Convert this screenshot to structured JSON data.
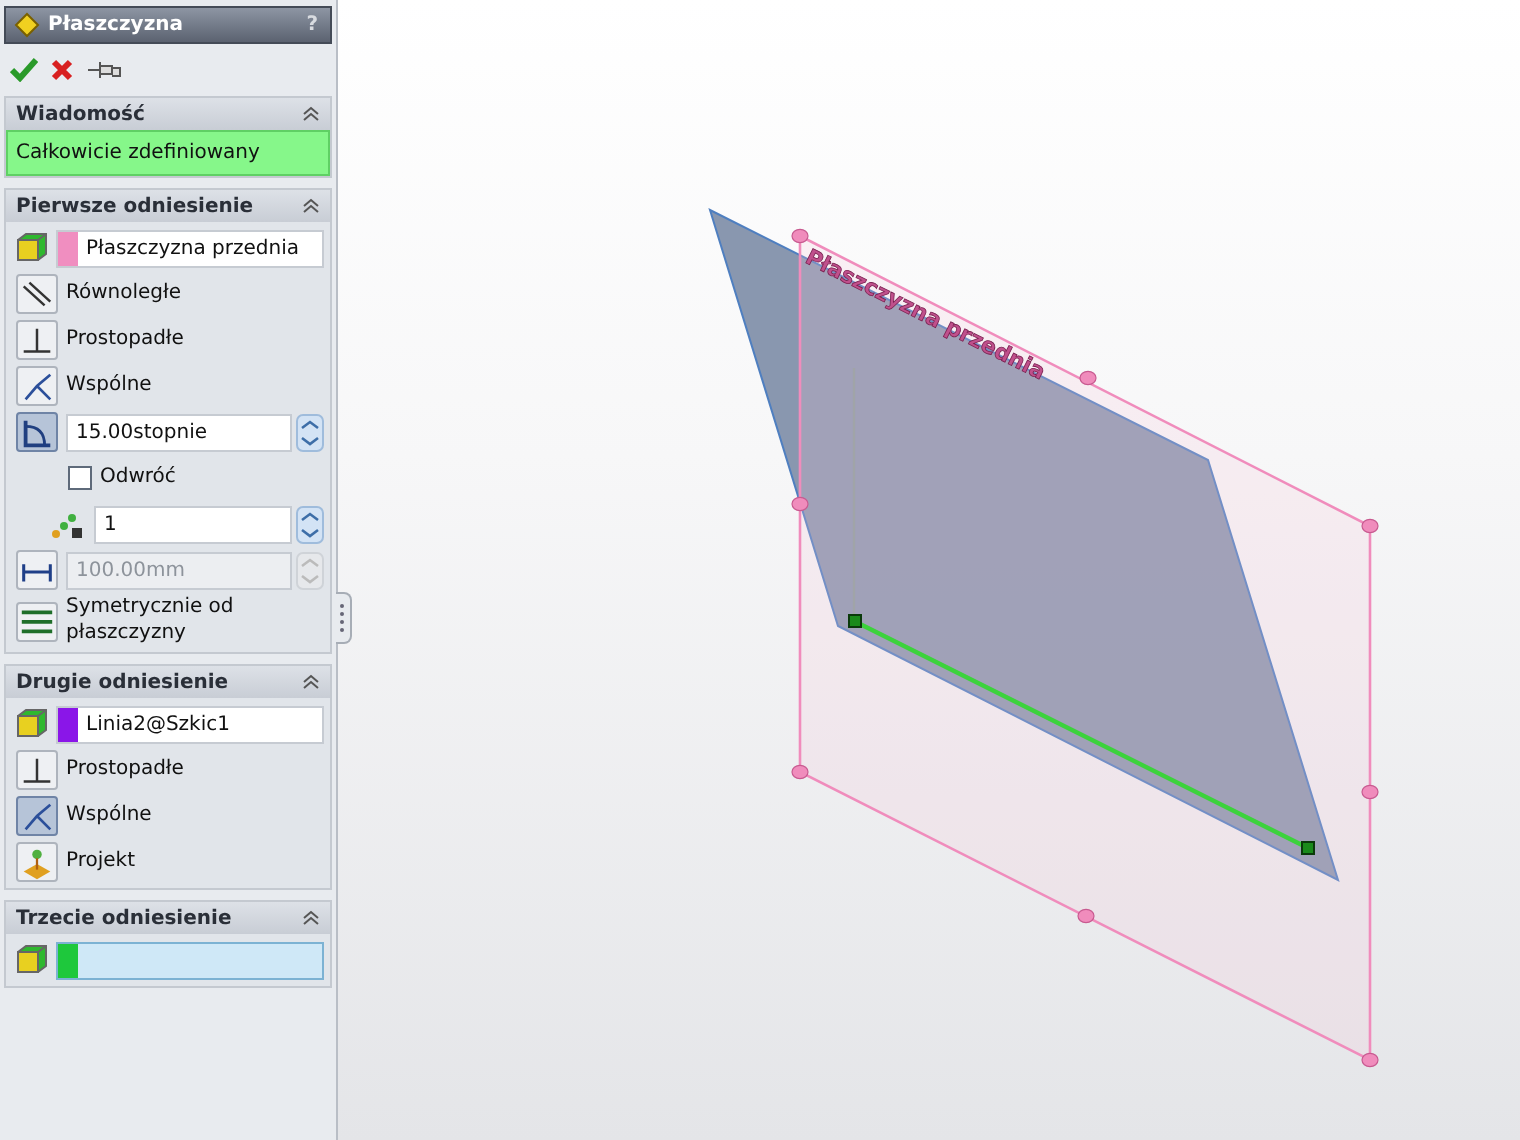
{
  "window": {
    "title": "Płaszczyzna",
    "help": "?"
  },
  "sections": [
    {
      "title": "Wiadomość",
      "expanded": true,
      "items": [
        {
          "kind": "message",
          "text": "Całkowicie zdefiniowany"
        }
      ]
    },
    {
      "title": "Pierwsze odniesienie",
      "expanded": true,
      "items": [
        {
          "kind": "selection",
          "value": "Płaszczyzna przednia",
          "color": "#f08ec0",
          "active": false
        },
        {
          "kind": "parallel",
          "label": "Równoległe",
          "selected": false
        },
        {
          "kind": "perpendicular",
          "label": "Prostopadłe",
          "selected": false
        },
        {
          "kind": "coincident",
          "label": "Wspólne",
          "selected": false
        },
        {
          "kind": "angle",
          "value": "15.00stopnie",
          "selected": true,
          "disabled": false
        },
        {
          "kind": "checkbox",
          "label": "Odwróć",
          "checked": false
        },
        {
          "kind": "count",
          "value": "1",
          "disabled": false
        },
        {
          "kind": "distance",
          "value": "100.00mm",
          "selected": false,
          "disabled": true
        },
        {
          "kind": "symmetric",
          "label": "Symetrycznie od płaszczyzny",
          "selected": false
        }
      ]
    },
    {
      "title": "Drugie odniesienie",
      "expanded": true,
      "items": [
        {
          "kind": "selection",
          "value": "Linia2@Szkic1",
          "color": "#8a16e8",
          "active": false
        },
        {
          "kind": "perpendicular",
          "label": "Prostopadłe",
          "selected": false
        },
        {
          "kind": "coincident",
          "label": "Wspólne",
          "selected": true
        },
        {
          "kind": "project",
          "label": "Projekt",
          "selected": false
        }
      ]
    },
    {
      "title": "Trzecie odniesienie",
      "expanded": true,
      "items": [
        {
          "kind": "selection",
          "value": "",
          "color": "#1ec83c",
          "active": true
        }
      ]
    }
  ],
  "viewport": {
    "plane_label": "Płaszczyzna przednia"
  }
}
